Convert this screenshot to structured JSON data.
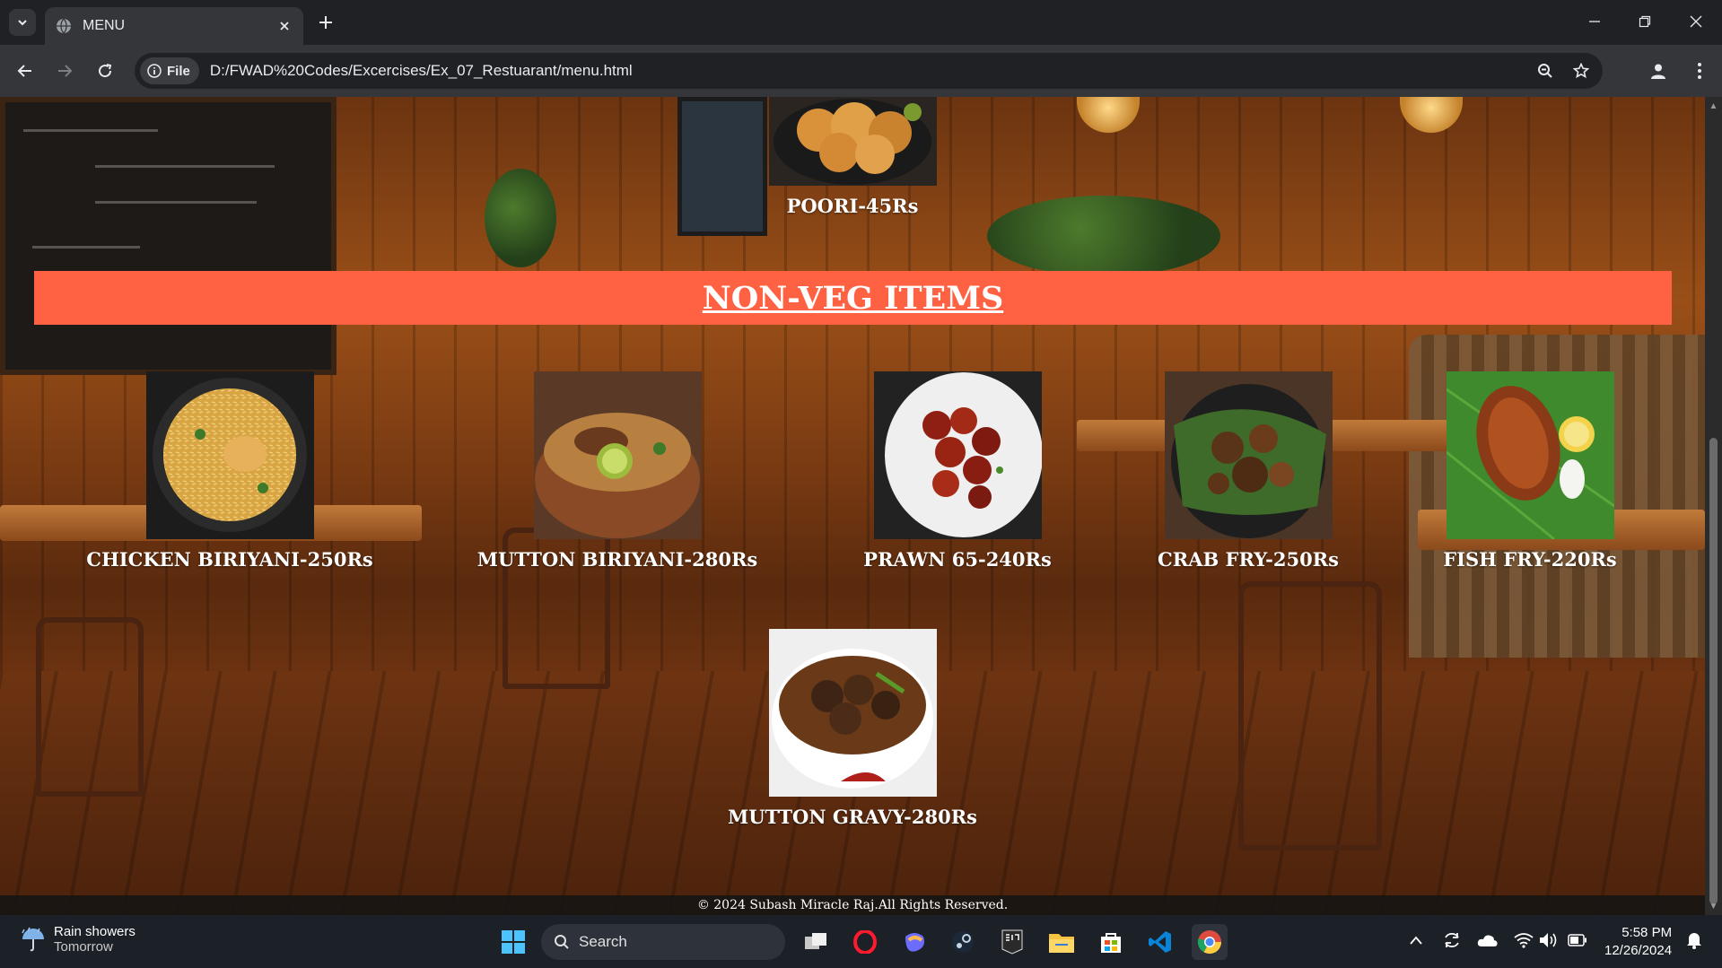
{
  "browser": {
    "tab_title": "MENU",
    "site_chip": "File",
    "url": "D:/FWAD%20Codes/Excercises/Ex_07_Restuarant/menu.html"
  },
  "page": {
    "top_item": {
      "name": "POORI-45Rs",
      "photo": "poori-photo"
    },
    "section_title": "NON-VEG ITEMS",
    "non_veg_items": [
      {
        "name": "CHICKEN BIRIYANI-250Rs",
        "photo": "chicken-biriyani-photo"
      },
      {
        "name": "MUTTON BIRIYANI-280Rs",
        "photo": "mutton-biriyani-photo"
      },
      {
        "name": "PRAWN 65-240Rs",
        "photo": "prawn-65-photo"
      },
      {
        "name": "CRAB FRY-250Rs",
        "photo": "crab-fry-photo"
      },
      {
        "name": "FISH FRY-220Rs",
        "photo": "fish-fry-photo"
      },
      {
        "name": "MUTTON GRAVY-280Rs",
        "photo": "mutton-gravy-photo"
      }
    ],
    "footer": "© 2024 Subash Miracle Raj.All Rights Reserved."
  },
  "taskbar": {
    "weather_line1": "Rain showers",
    "weather_line2": "Tomorrow",
    "search_placeholder": "Search",
    "time": "5:58 PM",
    "date": "12/26/2024"
  },
  "colors": {
    "banner": "#ff6242",
    "chrome_dark": "#202124",
    "chrome_toolbar": "#35363a"
  }
}
